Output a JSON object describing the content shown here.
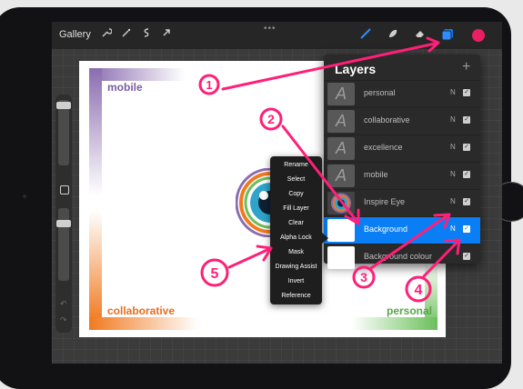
{
  "topbar": {
    "gallery_label": "Gallery",
    "more_dots": "•••"
  },
  "canvas": {
    "label_mobile": "mobile",
    "label_collaborative": "collaborative",
    "label_personal": "personal"
  },
  "layers_panel": {
    "title": "Layers",
    "add_symbol": "+",
    "layers": [
      {
        "name": "personal",
        "mode": "N",
        "thumb": "A",
        "selected": false
      },
      {
        "name": "collaborative",
        "mode": "N",
        "thumb": "A",
        "selected": false
      },
      {
        "name": "excellence",
        "mode": "N",
        "thumb": "A",
        "selected": false
      },
      {
        "name": "mobile",
        "mode": "N",
        "thumb": "A",
        "selected": false
      },
      {
        "name": "Inspire Eye",
        "mode": "N",
        "thumb": "",
        "selected": false
      },
      {
        "name": "Background",
        "mode": "N",
        "thumb": "",
        "selected": true
      },
      {
        "name": "Background colour",
        "mode": "",
        "thumb": "",
        "selected": false
      }
    ]
  },
  "context_menu": {
    "items": [
      "Rename",
      "Select",
      "Copy",
      "Fill Layer",
      "Clear",
      "Alpha Lock",
      "Mask",
      "Drawing Assist",
      "Invert",
      "Reference"
    ]
  },
  "annotations": [
    "1",
    "2",
    "3",
    "4",
    "5"
  ],
  "colors": {
    "accent_pink": "#e91e63",
    "selection_blue": "#0a7ef5",
    "purple": "#7b5da1",
    "orange": "#e96d1c",
    "green": "#5aa54a"
  }
}
